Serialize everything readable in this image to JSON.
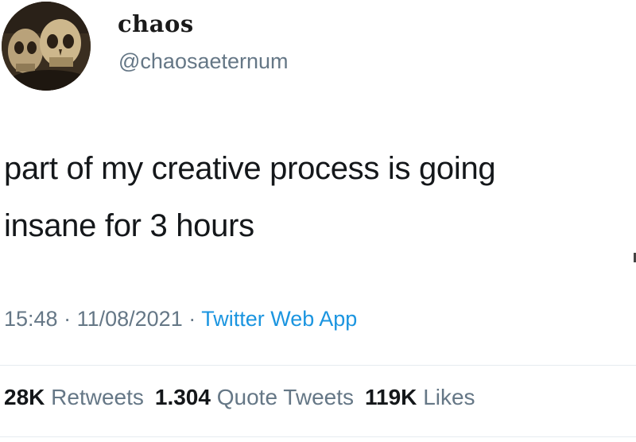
{
  "user": {
    "display_name": "chaos",
    "handle": "@chaosaeternum"
  },
  "tweet": {
    "text_line1": "part of my creative process is going",
    "text_line2": "insane for 3 hours"
  },
  "meta": {
    "time": "15:48",
    "separator": " · ",
    "date": "11/08/2021",
    "app": "Twitter Web App"
  },
  "stats": {
    "retweets_count": "28K",
    "retweets_label": "Retweets",
    "quotes_count": "1.304",
    "quotes_label": "Quote Tweets",
    "likes_count": "119K",
    "likes_label": "Likes"
  },
  "colors": {
    "link": "#1b95e0",
    "secondary_text": "#657786",
    "primary_text": "#14171a",
    "divider": "#e6ecf0"
  }
}
